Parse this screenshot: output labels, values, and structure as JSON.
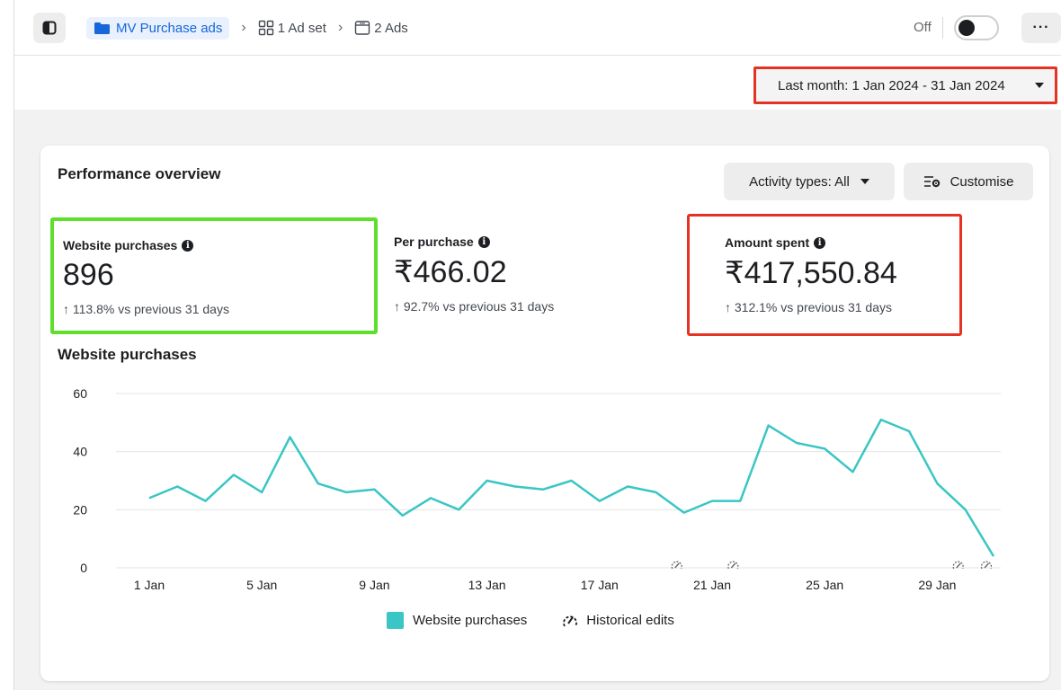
{
  "breadcrumb": {
    "campaign": "MV Purchase ads",
    "ad_set": "1 Ad set",
    "ads": "2 Ads"
  },
  "status": {
    "off_label": "Off",
    "toggle_on": false
  },
  "more_label": "···",
  "date_range": {
    "label": "Last month: 1 Jan 2024 - 31 Jan 2024"
  },
  "overview": {
    "title": "Performance overview",
    "activity_label": "Activity types: All",
    "customise_label": "Customise"
  },
  "metrics": [
    {
      "label": "Website purchases",
      "value": "896",
      "change": "↑ 113.8% vs previous 31 days"
    },
    {
      "label": "Per purchase",
      "value": "₹466.02",
      "change": "↑ 92.7% vs previous 31 days"
    },
    {
      "label": "Amount spent",
      "value": "₹417,550.84",
      "change": "↑ 312.1% vs previous 31 days"
    }
  ],
  "colors": {
    "accent": "#1667d9",
    "series": "#39c6c4",
    "highlight_green": "#5ee02b",
    "highlight_red": "#e53323"
  },
  "chart_data": {
    "type": "line",
    "title": "Website purchases",
    "x": [
      "1 Jan",
      "2 Jan",
      "3 Jan",
      "4 Jan",
      "5 Jan",
      "6 Jan",
      "7 Jan",
      "8 Jan",
      "9 Jan",
      "10 Jan",
      "11 Jan",
      "12 Jan",
      "13 Jan",
      "14 Jan",
      "15 Jan",
      "16 Jan",
      "17 Jan",
      "18 Jan",
      "19 Jan",
      "20 Jan",
      "21 Jan",
      "22 Jan",
      "23 Jan",
      "24 Jan",
      "25 Jan",
      "26 Jan",
      "27 Jan",
      "28 Jan",
      "29 Jan",
      "30 Jan",
      "31 Jan"
    ],
    "x_tick_labels": [
      "1 Jan",
      "5 Jan",
      "9 Jan",
      "13 Jan",
      "17 Jan",
      "21 Jan",
      "25 Jan",
      "29 Jan"
    ],
    "series": [
      {
        "name": "Website purchases",
        "values": [
          24,
          28,
          23,
          32,
          26,
          45,
          29,
          26,
          27,
          18,
          24,
          20,
          30,
          28,
          27,
          30,
          23,
          28,
          26,
          19,
          23,
          23,
          49,
          43,
          41,
          33,
          51,
          47,
          29,
          20,
          4
        ]
      }
    ],
    "ylim": [
      0,
      60
    ],
    "yticks": [
      0,
      20,
      40,
      60
    ],
    "grid": true,
    "historical_edit_days": [
      20,
      22,
      30,
      31
    ],
    "legend": {
      "series_label": "Website purchases",
      "edits_label": "Historical edits",
      "position": "bottom"
    }
  }
}
